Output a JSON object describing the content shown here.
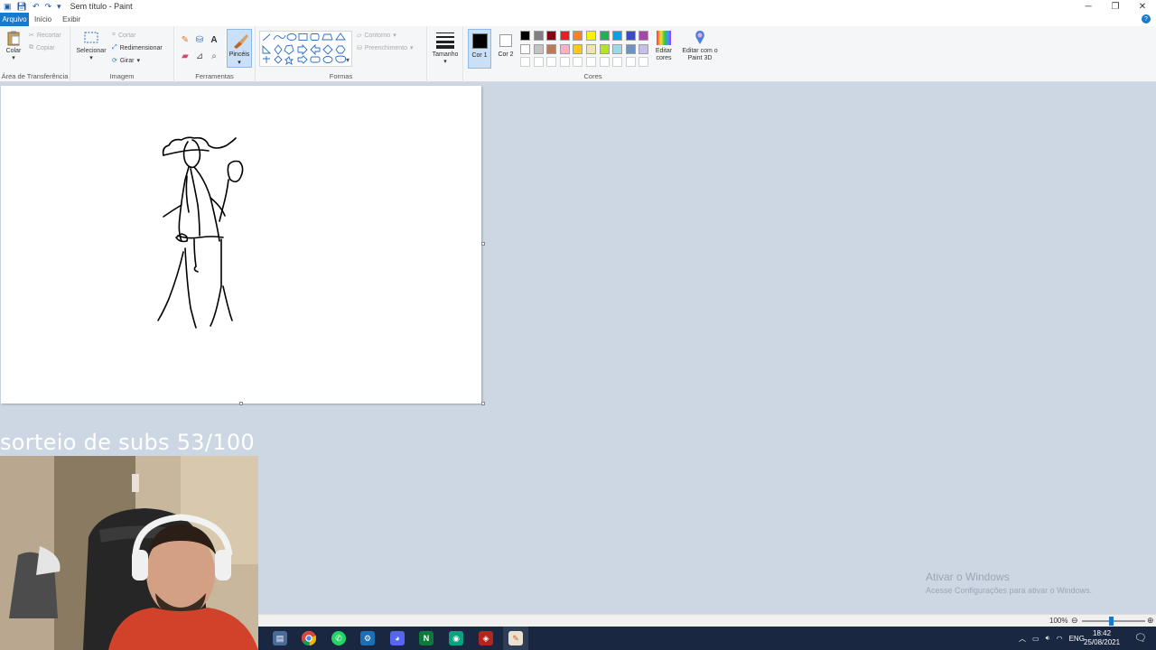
{
  "window": {
    "title": "Sem título - Paint"
  },
  "tabs": {
    "file": "Arquivo",
    "home": "Início",
    "view": "Exibir"
  },
  "ribbon": {
    "clipboard": {
      "label": "Área de Transferência",
      "paste": "Colar",
      "cut": "Recortar",
      "copy": "Copiar"
    },
    "image": {
      "label": "Imagem",
      "select": "Selecionar",
      "crop": "Cortar",
      "resize": "Redimensionar",
      "rotate": "Girar"
    },
    "tools": {
      "label": "Ferramentas",
      "brushes": "Pincéis"
    },
    "shapes": {
      "label": "Formas",
      "outline": "Contorno",
      "fill": "Preenchimento"
    },
    "size": {
      "label": "Tamanho"
    },
    "colors": {
      "label": "Cores",
      "color1": "Cor 1",
      "color2": "Cor 2",
      "edit": "Editar cores",
      "paint3d": "Editar com o Paint 3D",
      "color1_value": "#000000",
      "color2_value": "#ffffff",
      "palette_row1": [
        "#000000",
        "#7f7f7f",
        "#880015",
        "#ed1c24",
        "#ff7f27",
        "#fff200",
        "#22b14c",
        "#00a2e8",
        "#3f48cc",
        "#a349a4"
      ],
      "palette_row2": [
        "#ffffff",
        "#c3c3c3",
        "#b97a57",
        "#ffaec9",
        "#ffc90e",
        "#efe4b0",
        "#b5e61d",
        "#99d9ea",
        "#7092be",
        "#c8bfe7"
      ]
    }
  },
  "overlay": {
    "text": "sorteio de subs 53/100"
  },
  "activation": {
    "title": "Ativar o Windows",
    "subtitle": "Acesse Configurações para ativar o Windows."
  },
  "status": {
    "zoom": "100%"
  },
  "taskbar": {
    "language": "ENG",
    "time": "18:42",
    "date": "25/08/2021"
  }
}
